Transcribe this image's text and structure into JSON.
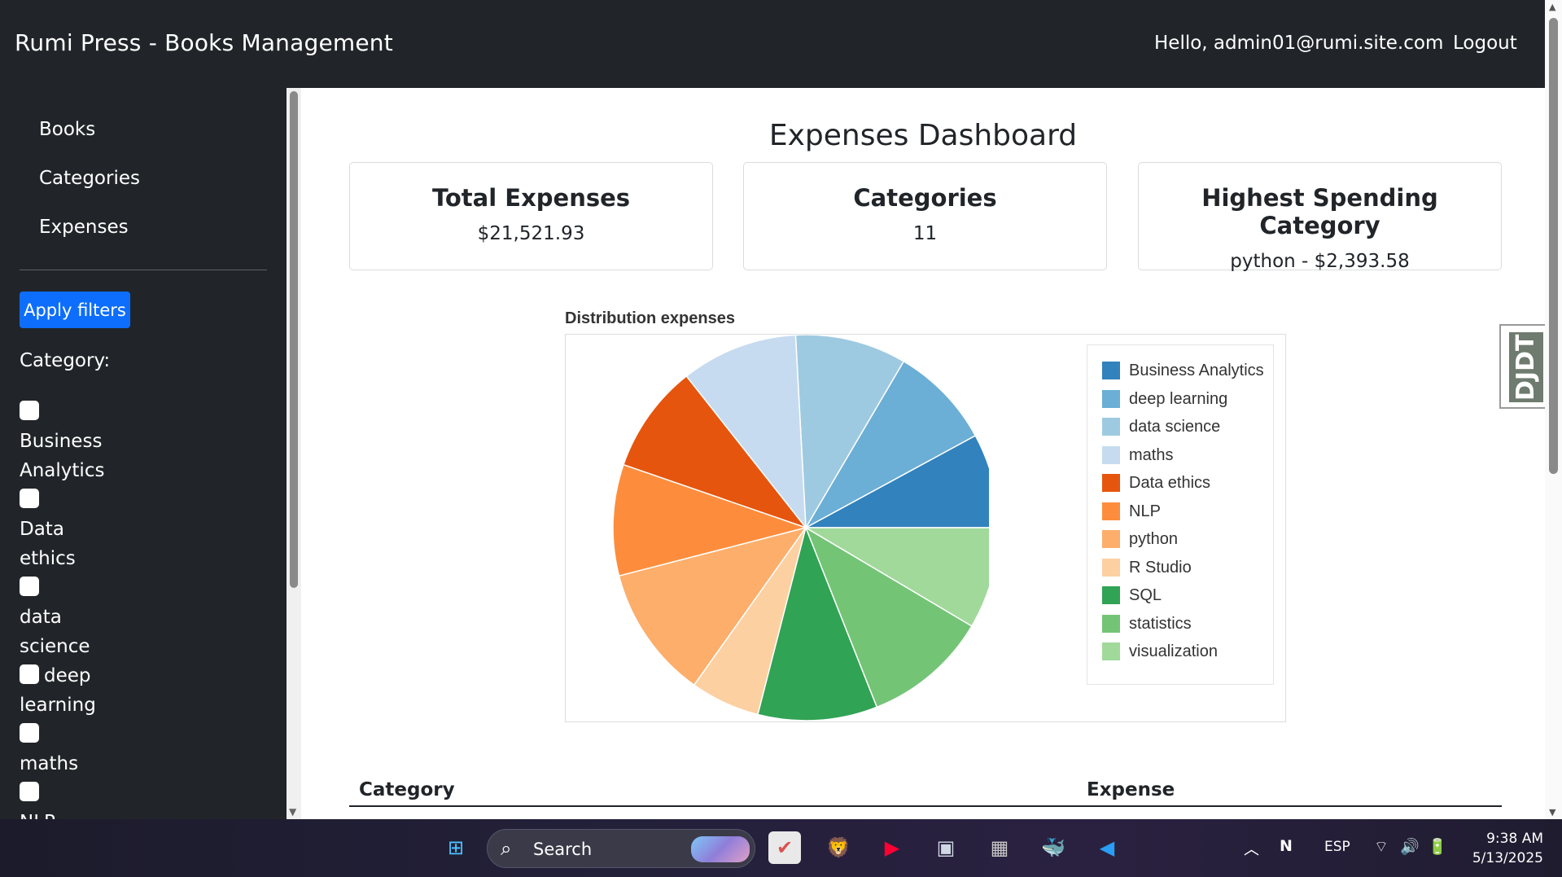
{
  "navbar": {
    "brand": "Rumi Press - Books Management",
    "greeting": "Hello, admin01@rumi.site.com",
    "logout": "Logout"
  },
  "sidebar": {
    "nav": [
      {
        "label": "Books"
      },
      {
        "label": "Categories"
      },
      {
        "label": "Expenses"
      }
    ],
    "apply_filters": "Apply filters",
    "category_label": "Category:",
    "filters": [
      {
        "label": "Business Analytics"
      },
      {
        "label": "Data ethics"
      },
      {
        "label": "data science"
      },
      {
        "label": "deep learning"
      },
      {
        "label": "maths"
      },
      {
        "label": "NLP"
      }
    ]
  },
  "main": {
    "title": "Expenses Dashboard",
    "cards": [
      {
        "title": "Total Expenses",
        "value": "$21,521.93"
      },
      {
        "title": "Categories",
        "value": "11"
      },
      {
        "title": "Highest Spending Category",
        "value": "python - $2,393.58"
      }
    ],
    "table": {
      "columns": [
        "Category",
        "Expense"
      ]
    }
  },
  "side_widget": {
    "label": "DJDT"
  },
  "chart_data": {
    "type": "pie",
    "title": "Distribution expenses",
    "legend_position": "right",
    "categories": [
      "Business Analytics",
      "deep learning",
      "data science",
      "maths",
      "Data ethics",
      "NLP",
      "python",
      "R Studio",
      "SQL",
      "statistics",
      "visualization"
    ],
    "values": [
      1700,
      1850,
      2000,
      2100,
      1950,
      2000,
      2393.58,
      1250,
      2150,
      2250,
      1828.35
    ],
    "colors": [
      "#3182bd",
      "#6baed6",
      "#9ecae1",
      "#c6dbef",
      "#e6550d",
      "#fd8d3c",
      "#fdae6b",
      "#fdd0a2",
      "#31a354",
      "#74c476",
      "#a1d99b"
    ],
    "start_angle_deg": 0
  },
  "taskbar": {
    "search_placeholder": "Search",
    "language": "ESP",
    "time": "9:38 AM",
    "date": "5/13/2025",
    "apps": [
      {
        "icon": "windows-start-icon"
      },
      {
        "icon": "todo-app-icon"
      },
      {
        "icon": "brave-browser-icon"
      },
      {
        "icon": "youtube-music-icon"
      },
      {
        "icon": "storage-app-icon"
      },
      {
        "icon": "calculator-icon"
      },
      {
        "icon": "docker-icon"
      },
      {
        "icon": "vscode-icon"
      }
    ]
  }
}
